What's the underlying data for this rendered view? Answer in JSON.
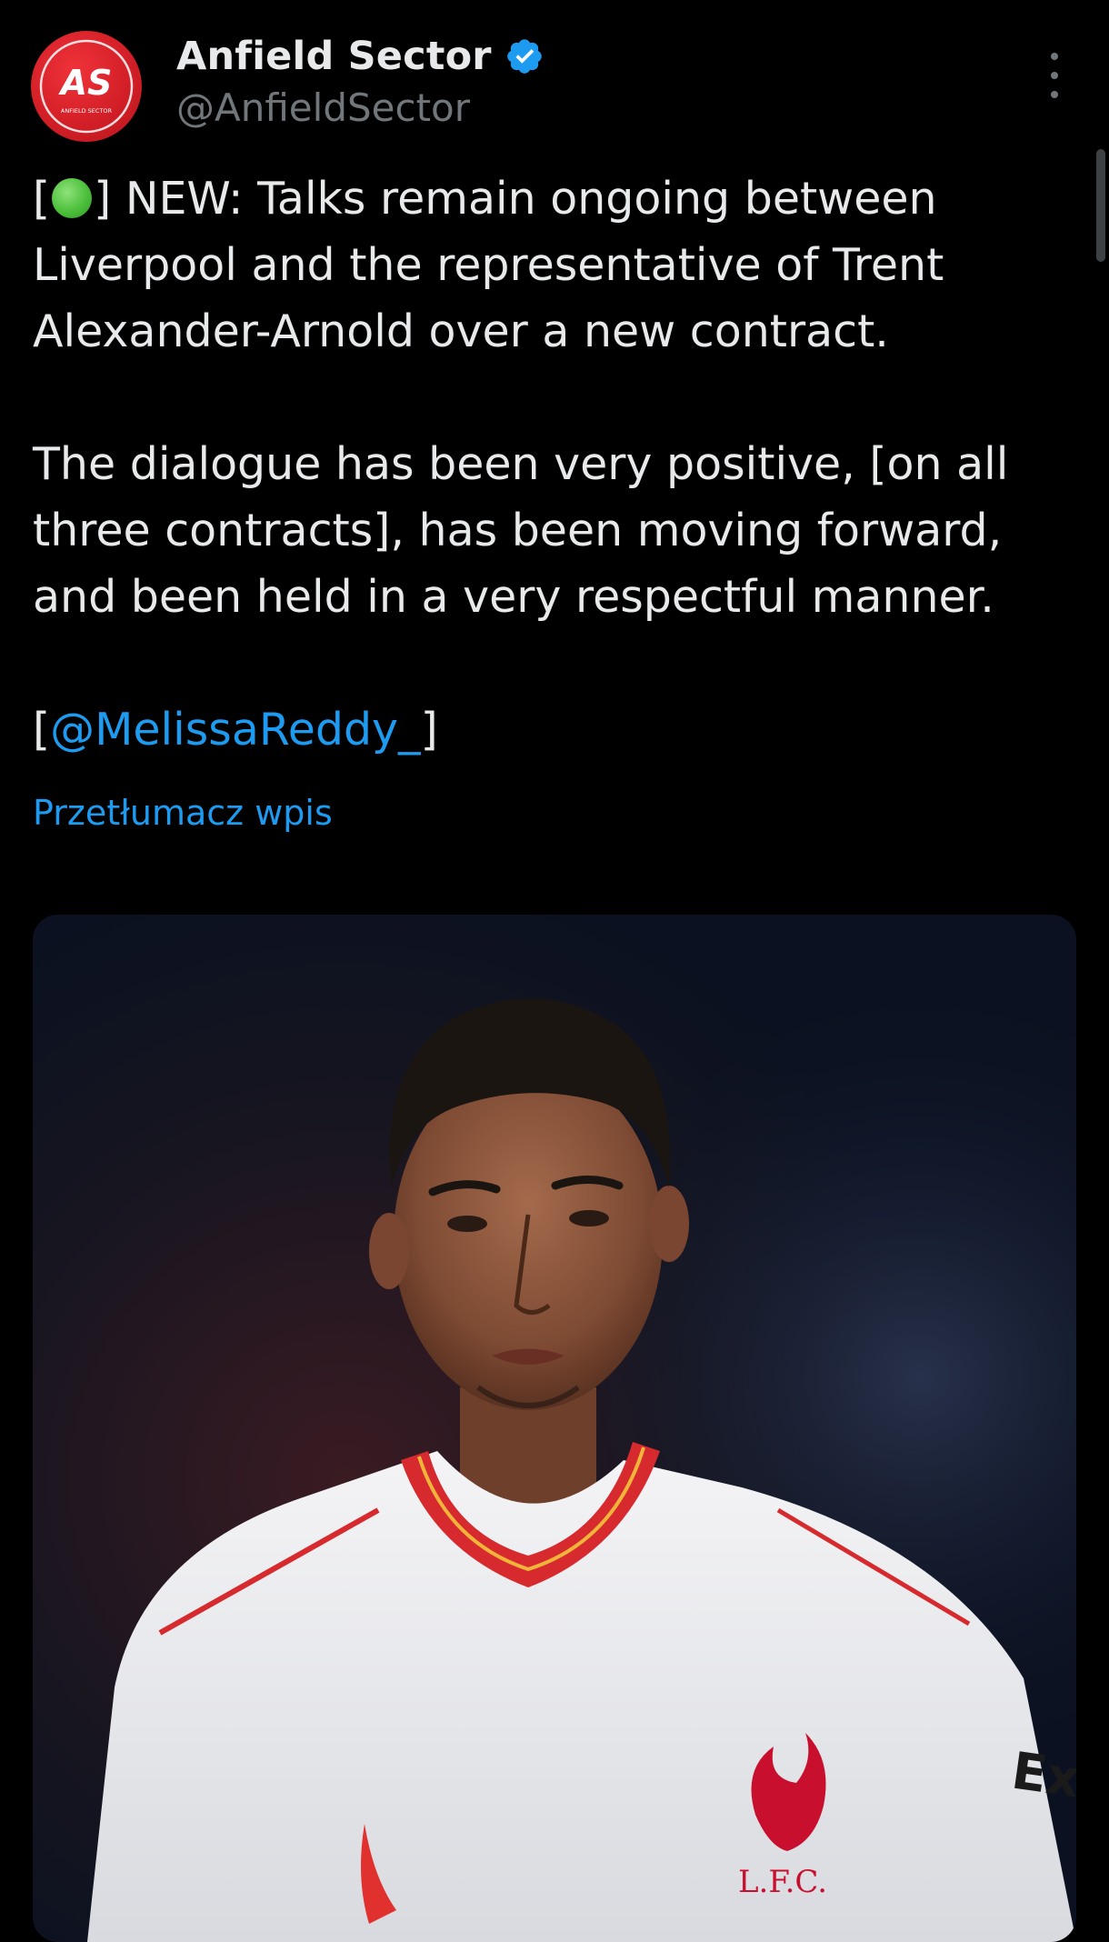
{
  "author": {
    "name": "Anfield Sector",
    "handle": "@AnfieldSector",
    "avatar_initials": "AS",
    "avatar_subtext": "ANFIELD SECTOR",
    "verified": true
  },
  "tweet": {
    "paragraphs": [
      {
        "prefix": "[",
        "emoji": "green-circle",
        "text": "] NEW: Talks remain ongoing between Liverpool and the representative of Trent Alexander-Arnold over a new contract."
      },
      {
        "text": "The dialogue has been very positive, [on all three contracts], has been moving forward, and been held in a very respectful manner."
      },
      {
        "prefix": "[",
        "mention": "@MelissaReddy_",
        "suffix": "]"
      }
    ],
    "translate_label": "Przetłumacz wpis"
  },
  "media": {
    "type": "photo",
    "subject": "football-player-portrait",
    "shirt_sponsor_text": "Ex",
    "crest_text": "L.F.C."
  },
  "colors": {
    "background": "#000000",
    "text": "#e7e9ea",
    "muted": "#71767b",
    "accent": "#1d9bf0",
    "avatar_red": "#d31f27"
  }
}
